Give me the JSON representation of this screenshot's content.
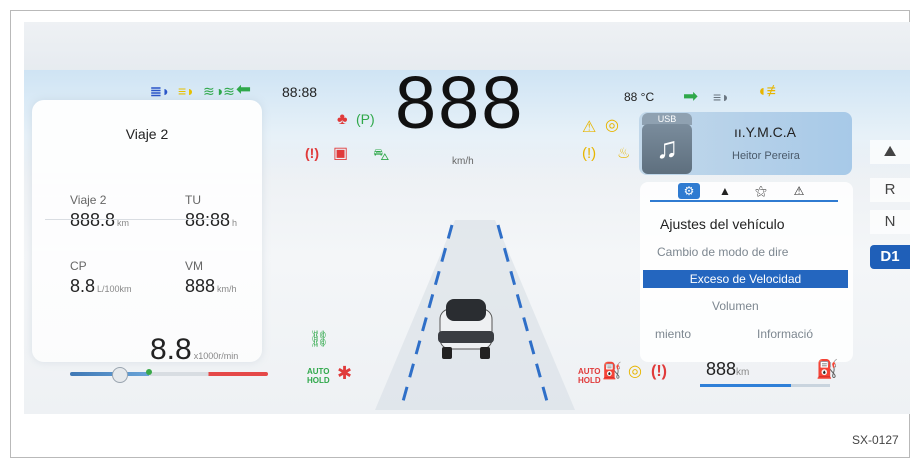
{
  "figure_code": "SX-0127",
  "colors": {
    "accent": "#2466bf",
    "warning_red": "#e03a3a",
    "indicator_green": "#3aa84a",
    "indicator_yellow": "#e7b500"
  },
  "header": {
    "clock": "88:88",
    "speed": "888",
    "speed_unit": "km/h",
    "outside_temp": "88 °C"
  },
  "trip": {
    "title": "Viaje 2",
    "cells": [
      {
        "label": "Viaje 2",
        "value": "888.8",
        "unit": "km"
      },
      {
        "label": "TU",
        "value": "88:88",
        "unit": "h"
      },
      {
        "label": "CP",
        "value": "8.8",
        "unit": "L/100km"
      },
      {
        "label": "VM",
        "value": "888",
        "unit": "km/h"
      }
    ],
    "rpm_value": "8.8",
    "rpm_unit": "x1000r/min"
  },
  "media": {
    "source": "USB",
    "song": "ıı.Y.M.C.A",
    "artist": "Heitor Pereira",
    "icon": "music-note-icon"
  },
  "menu": {
    "tabs": [
      "settings-icon",
      "navigation-icon",
      "driver-assist-icon",
      "warning-icon"
    ],
    "selected_tab": 0,
    "title": "Ajustes del vehículo",
    "items": [
      "Cambio de modo de dire",
      "Exceso de Velocidad",
      "Volumen"
    ],
    "selected_item": "Exceso de Velocidad",
    "bottom_left": "miento",
    "bottom_right": "Informació"
  },
  "gears": {
    "items": [
      "R",
      "N",
      "D1"
    ],
    "selected": "D1"
  },
  "fuel": {
    "value": "888",
    "unit": "km",
    "level_fraction": 0.7
  },
  "icons_left_top": [
    "high-beam-icon",
    "low-beam-icon",
    "fog-light-icon",
    "turn-left-icon"
  ],
  "icons_right_top": [
    "turn-right-icon",
    "headlight-icon",
    "rear-fog-icon"
  ],
  "icons_center_top": [
    "seatbelt-icon",
    "park-brake-icon",
    "brake-warning-icon",
    "battery-icon",
    "traction-icon"
  ],
  "icons_right_cluster": [
    "warning-triangle-icon",
    "steering-icon",
    "tire-pressure-icon",
    "coolant-icon"
  ],
  "icons_bottom_left": [
    "gear-shift-icon",
    "auto-hold-icon",
    "airbag-icon"
  ],
  "icons_bottom_right": [
    "auto-hold-icon",
    "oil-pressure-icon",
    "abs-icon",
    "brake-icon",
    "fuel-pump-icon"
  ],
  "labels": {
    "auto_hold": "AUTO HOLD"
  }
}
